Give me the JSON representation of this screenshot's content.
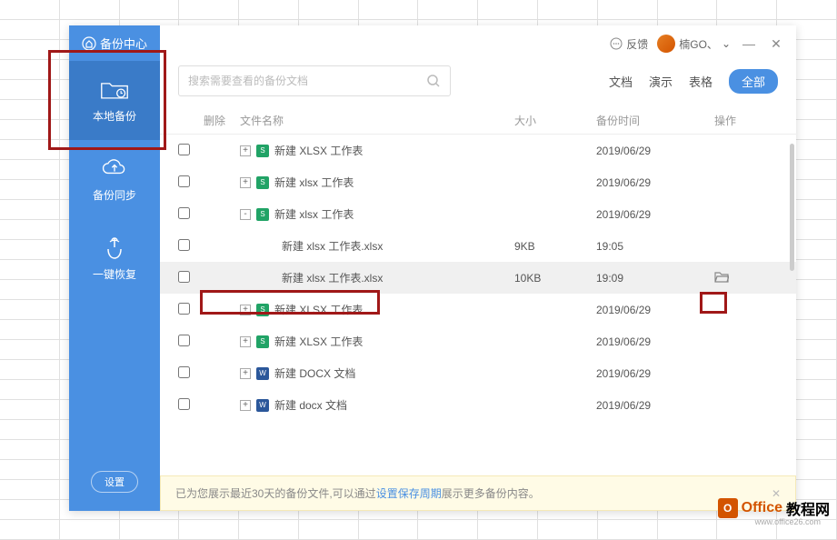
{
  "sidebar": {
    "title": "备份中心",
    "items": [
      {
        "label": "本地备份",
        "icon": "folder-icon",
        "active": true
      },
      {
        "label": "备份同步",
        "icon": "cloud-icon",
        "active": false
      },
      {
        "label": "一键恢复",
        "icon": "touch-icon",
        "active": false
      }
    ],
    "settings_label": "设置"
  },
  "titlebar": {
    "feedback_label": "反馈",
    "user_name": "楠GO、",
    "minimize": "—",
    "close": "✕"
  },
  "search": {
    "placeholder": "搜索需要查看的备份文档"
  },
  "filters": {
    "doc": "文档",
    "slide": "演示",
    "sheet": "表格",
    "all": "全部"
  },
  "columns": {
    "delete": "删除",
    "name": "文件名称",
    "size": "大小",
    "time": "备份时间",
    "op": "操作"
  },
  "rows": [
    {
      "type": "parent",
      "icon": "xlsx",
      "name": "新建 XLSX 工作表",
      "expand": "+",
      "time": "2019/06/29"
    },
    {
      "type": "parent",
      "icon": "xlsx",
      "name": "新建 xlsx 工作表",
      "expand": "+",
      "time": "2019/06/29"
    },
    {
      "type": "parent",
      "icon": "xlsx",
      "name": "新建 xlsx 工作表",
      "expand": "-",
      "time": "2019/06/29"
    },
    {
      "type": "child",
      "name": "新建 xlsx 工作表.xlsx",
      "size": "9KB",
      "time": "19:05"
    },
    {
      "type": "child",
      "name": "新建 xlsx 工作表.xlsx",
      "size": "10KB",
      "time": "19:09",
      "selected": true,
      "op_icon": true
    },
    {
      "type": "parent",
      "icon": "xlsx",
      "name": "新建 XLSX 工作表",
      "expand": "+",
      "time": "2019/06/29"
    },
    {
      "type": "parent",
      "icon": "xlsx",
      "name": "新建 XLSX 工作表",
      "expand": "+",
      "time": "2019/06/29"
    },
    {
      "type": "parent",
      "icon": "docx",
      "name": "新建 DOCX 文档",
      "expand": "+",
      "time": "2019/06/29"
    },
    {
      "type": "parent",
      "icon": "docx",
      "name": "新建 docx 文档",
      "expand": "+",
      "time": "2019/06/29"
    }
  ],
  "footer": {
    "text_prefix": "已为您展示最近30天的备份文件,可以通过 ",
    "link": "设置保存周期",
    "text_suffix": " 展示更多备份内容。"
  },
  "watermark": {
    "t1": "Office",
    "t2": "教程网",
    "sub": "www.office26.com"
  }
}
